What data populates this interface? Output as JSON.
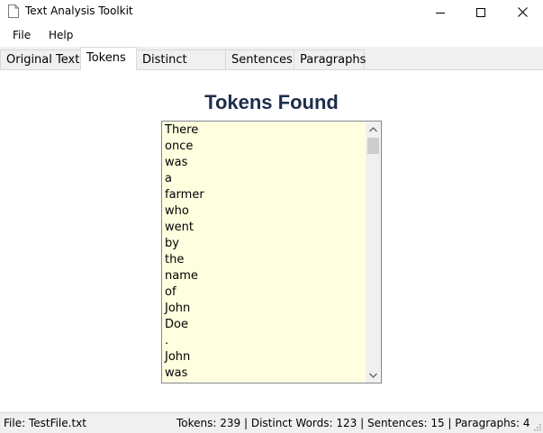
{
  "window": {
    "title": "Text Analysis Toolkit",
    "icons": [
      "document-icon",
      "minimize-icon",
      "maximize-icon",
      "close-icon"
    ]
  },
  "menu": {
    "file": "File",
    "help": "Help"
  },
  "tabs": [
    {
      "label": "Original Text",
      "active": false
    },
    {
      "label": "Tokens",
      "active": true
    },
    {
      "label": "Distinct Words",
      "active": false
    },
    {
      "label": "Sentences",
      "active": false
    },
    {
      "label": "Paragraphs",
      "active": false
    }
  ],
  "main": {
    "heading": "Tokens Found",
    "heading_color": "#1c2e4a",
    "list_background": "#ffffe0",
    "tokens": [
      "There",
      "once",
      "was",
      "a",
      "farmer",
      "who",
      "went",
      "by",
      "the",
      "name",
      "of",
      "John",
      "Doe",
      ".",
      "John",
      "was"
    ]
  },
  "status": {
    "file": "File: TestFile.txt",
    "stats": "Tokens: 239  |  Distinct Words: 123  |  Sentences: 15  |  Paragraphs: 4"
  }
}
